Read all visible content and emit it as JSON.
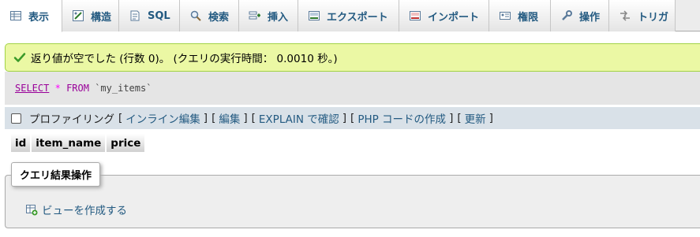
{
  "tabs": [
    {
      "label": "表示",
      "icon": "browse-icon",
      "active": true
    },
    {
      "label": "構造",
      "icon": "structure-icon",
      "active": false
    },
    {
      "label": "SQL",
      "icon": "sql-icon",
      "active": false
    },
    {
      "label": "検索",
      "icon": "search-icon",
      "active": false
    },
    {
      "label": "挿入",
      "icon": "insert-icon",
      "active": false
    },
    {
      "label": "エクスポート",
      "icon": "export-icon",
      "active": false
    },
    {
      "label": "インポート",
      "icon": "import-icon",
      "active": false
    },
    {
      "label": "権限",
      "icon": "privileges-icon",
      "active": false
    },
    {
      "label": "操作",
      "icon": "wrench-icon",
      "active": false
    },
    {
      "label": "トリガ",
      "icon": "triggers-icon",
      "active": false
    }
  ],
  "message": {
    "text": "返り値が空でした (行数 0)。 (クエリの実行時間： 0.0010 秒。)",
    "icon": "check-icon"
  },
  "sql": {
    "select": "SELECT",
    "star": "*",
    "from": "FROM",
    "table": "`my_items`"
  },
  "profiling": {
    "label": "プロファイリング",
    "open": "[",
    "close": "]",
    "links": [
      "インライン編集",
      "編集",
      "EXPLAIN で確認",
      "PHP コードの作成",
      "更新"
    ]
  },
  "columns": [
    "id",
    "item_name",
    "price"
  ],
  "operations": {
    "legend": "クエリ結果操作",
    "create_view": "ビューを作成する",
    "create_view_icon": "create-view-icon"
  },
  "colors": {
    "link": "#235a81",
    "success_bg": "#ebf8a4",
    "success_border": "#a2d246",
    "sql_keyword": "#990099"
  }
}
